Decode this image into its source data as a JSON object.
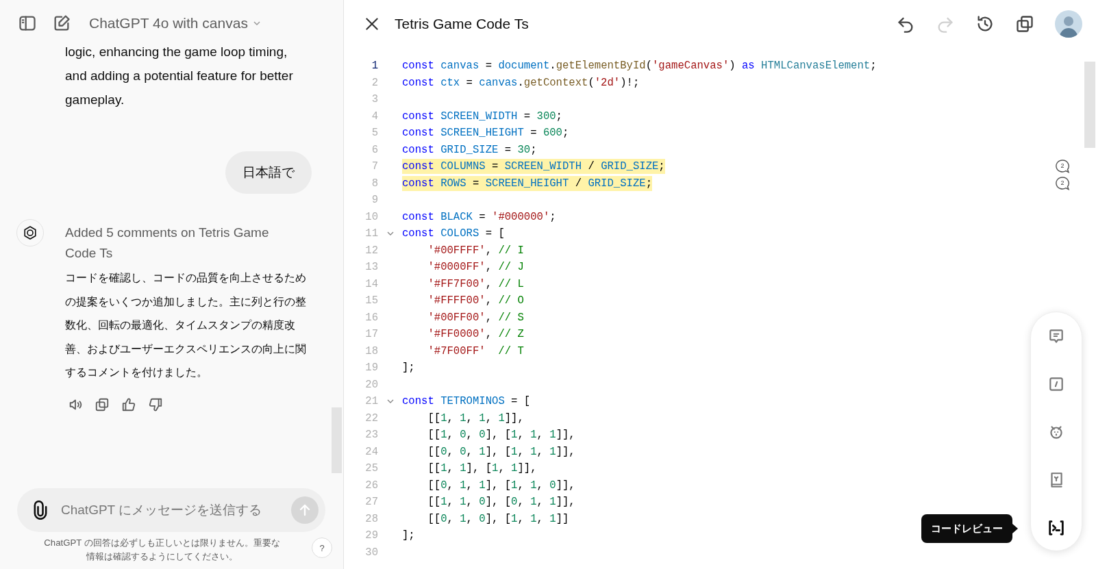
{
  "chat": {
    "model_selector": {
      "label": "ChatGPT 4o with canvas"
    },
    "messages": [
      {
        "kind": "assistant_text",
        "text": "logic, enhancing the game loop timing, and adding a potential feature for better gameplay."
      },
      {
        "kind": "user",
        "text": "日本語で"
      },
      {
        "kind": "assistant",
        "status": "Added 5 comments on Tetris Game Code Ts",
        "text": "コードを確認し、コードの品質を向上させるための提案をいくつか追加しました。主に列と行の整数化、回転の最適化、タイムスタンプの精度改善、およびユーザーエクスペリエンスの向上に関するコメントを付けました。"
      }
    ],
    "composer": {
      "placeholder": "ChatGPT にメッセージを送信する",
      "send_disabled": true
    },
    "disclaimer": "ChatGPT の回答は必ずしも正しいとは限りません。重要な情報は確認するようにしてください。",
    "help": "?"
  },
  "canvas": {
    "title": "Tetris Game Code Ts",
    "actions": [
      {
        "kind": "undo",
        "disabled": false
      },
      {
        "kind": "redo",
        "disabled": true
      },
      {
        "kind": "history",
        "disabled": false
      },
      {
        "kind": "copy",
        "disabled": false
      }
    ],
    "lines": [
      {
        "number": "1",
        "current": true,
        "highlighted": false,
        "tokens": [
          {
            "kind": "kw",
            "text": "const "
          },
          {
            "kind": "var",
            "text": "canvas"
          },
          {
            "kind": "plain",
            "text": " = "
          },
          {
            "kind": "var",
            "text": "document"
          },
          {
            "kind": "plain",
            "text": "."
          },
          {
            "kind": "fn",
            "text": "getElementById"
          },
          {
            "kind": "plain",
            "text": "("
          },
          {
            "kind": "str",
            "text": "'gameCanvas'"
          },
          {
            "kind": "plain",
            "text": ") "
          },
          {
            "kind": "kw",
            "text": "as "
          },
          {
            "kind": "type",
            "text": "HTMLCanvasElement"
          },
          {
            "kind": "plain",
            "text": ";"
          }
        ]
      },
      {
        "number": "2",
        "current": false,
        "highlighted": false,
        "tokens": [
          {
            "kind": "kw",
            "text": "const "
          },
          {
            "kind": "var",
            "text": "ctx"
          },
          {
            "kind": "plain",
            "text": " = "
          },
          {
            "kind": "var",
            "text": "canvas"
          },
          {
            "kind": "plain",
            "text": "."
          },
          {
            "kind": "fn",
            "text": "getContext"
          },
          {
            "kind": "plain",
            "text": "("
          },
          {
            "kind": "str",
            "text": "'2d'"
          },
          {
            "kind": "plain",
            "text": ")!;"
          }
        ]
      },
      {
        "number": "3",
        "current": false,
        "highlighted": false
      },
      {
        "number": "4",
        "current": false,
        "highlighted": false,
        "tokens": [
          {
            "kind": "kw",
            "text": "const "
          },
          {
            "kind": "var",
            "text": "SCREEN_WIDTH"
          },
          {
            "kind": "plain",
            "text": " = "
          },
          {
            "kind": "num",
            "text": "300"
          },
          {
            "kind": "plain",
            "text": ";"
          }
        ]
      },
      {
        "number": "5",
        "current": false,
        "highlighted": false,
        "tokens": [
          {
            "kind": "kw",
            "text": "const "
          },
          {
            "kind": "var",
            "text": "SCREEN_HEIGHT"
          },
          {
            "kind": "plain",
            "text": " = "
          },
          {
            "kind": "num",
            "text": "600"
          },
          {
            "kind": "plain",
            "text": ";"
          }
        ]
      },
      {
        "number": "6",
        "current": false,
        "highlighted": false,
        "tokens": [
          {
            "kind": "kw",
            "text": "const "
          },
          {
            "kind": "var",
            "text": "GRID_SIZE"
          },
          {
            "kind": "plain",
            "text": " = "
          },
          {
            "kind": "num",
            "text": "30"
          },
          {
            "kind": "plain",
            "text": ";"
          }
        ]
      },
      {
        "number": "7",
        "current": false,
        "highlighted": true,
        "comments": "2",
        "tokens": [
          {
            "kind": "kw",
            "text": "const "
          },
          {
            "kind": "var",
            "text": "COLUMNS"
          },
          {
            "kind": "plain",
            "text": " = "
          },
          {
            "kind": "var",
            "text": "SCREEN_WIDTH"
          },
          {
            "kind": "plain",
            "text": " / "
          },
          {
            "kind": "var",
            "text": "GRID_SIZE"
          },
          {
            "kind": "plain",
            "text": ";"
          }
        ]
      },
      {
        "number": "8",
        "current": false,
        "highlighted": true,
        "comments": "2",
        "tokens": [
          {
            "kind": "kw",
            "text": "const "
          },
          {
            "kind": "var",
            "text": "ROWS"
          },
          {
            "kind": "plain",
            "text": " = "
          },
          {
            "kind": "var",
            "text": "SCREEN_HEIGHT"
          },
          {
            "kind": "plain",
            "text": " / "
          },
          {
            "kind": "var",
            "text": "GRID_SIZE"
          },
          {
            "kind": "plain",
            "text": ";"
          }
        ]
      },
      {
        "number": "9",
        "current": false,
        "highlighted": false
      },
      {
        "number": "10",
        "current": false,
        "highlighted": false,
        "tokens": [
          {
            "kind": "kw",
            "text": "const "
          },
          {
            "kind": "var",
            "text": "BLACK"
          },
          {
            "kind": "plain",
            "text": " = "
          },
          {
            "kind": "str",
            "text": "'#000000'"
          },
          {
            "kind": "plain",
            "text": ";"
          }
        ]
      },
      {
        "number": "11",
        "current": false,
        "highlighted": false,
        "expanded": true,
        "tokens": [
          {
            "kind": "kw",
            "text": "const "
          },
          {
            "kind": "var",
            "text": "COLORS"
          },
          {
            "kind": "plain",
            "text": " = ["
          }
        ]
      },
      {
        "number": "12",
        "current": false,
        "highlighted": false,
        "tokens": [
          {
            "kind": "str",
            "text": "    '#00FFFF'"
          },
          {
            "kind": "plain",
            "text": ", "
          },
          {
            "kind": "cmt",
            "text": "// I"
          }
        ]
      },
      {
        "number": "13",
        "current": false,
        "highlighted": false,
        "tokens": [
          {
            "kind": "str",
            "text": "    '#0000FF'"
          },
          {
            "kind": "plain",
            "text": ", "
          },
          {
            "kind": "cmt",
            "text": "// J"
          }
        ]
      },
      {
        "number": "14",
        "current": false,
        "highlighted": false,
        "tokens": [
          {
            "kind": "str",
            "text": "    '#FF7F00'"
          },
          {
            "kind": "plain",
            "text": ", "
          },
          {
            "kind": "cmt",
            "text": "// L"
          }
        ]
      },
      {
        "number": "15",
        "current": false,
        "highlighted": false,
        "tokens": [
          {
            "kind": "str",
            "text": "    '#FFFF00'"
          },
          {
            "kind": "plain",
            "text": ", "
          },
          {
            "kind": "cmt",
            "text": "// O"
          }
        ]
      },
      {
        "number": "16",
        "current": false,
        "highlighted": false,
        "tokens": [
          {
            "kind": "str",
            "text": "    '#00FF00'"
          },
          {
            "kind": "plain",
            "text": ", "
          },
          {
            "kind": "cmt",
            "text": "// S"
          }
        ]
      },
      {
        "number": "17",
        "current": false,
        "highlighted": false,
        "tokens": [
          {
            "kind": "str",
            "text": "    '#FF0000'"
          },
          {
            "kind": "plain",
            "text": ", "
          },
          {
            "kind": "cmt",
            "text": "// Z"
          }
        ]
      },
      {
        "number": "18",
        "current": false,
        "highlighted": false,
        "tokens": [
          {
            "kind": "str",
            "text": "    '#7F00FF'"
          },
          {
            "kind": "cmt",
            "text": "  // T"
          }
        ]
      },
      {
        "number": "19",
        "current": false,
        "highlighted": false,
        "tokens": [
          {
            "kind": "plain",
            "text": "];"
          }
        ]
      },
      {
        "number": "20",
        "current": false,
        "highlighted": false
      },
      {
        "number": "21",
        "current": false,
        "highlighted": false,
        "expanded": true,
        "tokens": [
          {
            "kind": "kw",
            "text": "const "
          },
          {
            "kind": "var",
            "text": "TETROMINOS"
          },
          {
            "kind": "plain",
            "text": " = ["
          }
        ]
      },
      {
        "number": "22",
        "current": false,
        "highlighted": false,
        "tokens": [
          {
            "kind": "plain",
            "text": "    [["
          },
          {
            "kind": "num",
            "text": "1"
          },
          {
            "kind": "plain",
            "text": ", "
          },
          {
            "kind": "num",
            "text": "1"
          },
          {
            "kind": "plain",
            "text": ", "
          },
          {
            "kind": "num",
            "text": "1"
          },
          {
            "kind": "plain",
            "text": ", "
          },
          {
            "kind": "num",
            "text": "1"
          },
          {
            "kind": "plain",
            "text": "]],"
          }
        ]
      },
      {
        "number": "23",
        "current": false,
        "highlighted": false,
        "tokens": [
          {
            "kind": "plain",
            "text": "    [["
          },
          {
            "kind": "num",
            "text": "1"
          },
          {
            "kind": "plain",
            "text": ", "
          },
          {
            "kind": "num",
            "text": "0"
          },
          {
            "kind": "plain",
            "text": ", "
          },
          {
            "kind": "num",
            "text": "0"
          },
          {
            "kind": "plain",
            "text": "], ["
          },
          {
            "kind": "num",
            "text": "1"
          },
          {
            "kind": "plain",
            "text": ", "
          },
          {
            "kind": "num",
            "text": "1"
          },
          {
            "kind": "plain",
            "text": ", "
          },
          {
            "kind": "num",
            "text": "1"
          },
          {
            "kind": "plain",
            "text": "]],"
          }
        ]
      },
      {
        "number": "24",
        "current": false,
        "highlighted": false,
        "tokens": [
          {
            "kind": "plain",
            "text": "    [["
          },
          {
            "kind": "num",
            "text": "0"
          },
          {
            "kind": "plain",
            "text": ", "
          },
          {
            "kind": "num",
            "text": "0"
          },
          {
            "kind": "plain",
            "text": ", "
          },
          {
            "kind": "num",
            "text": "1"
          },
          {
            "kind": "plain",
            "text": "], ["
          },
          {
            "kind": "num",
            "text": "1"
          },
          {
            "kind": "plain",
            "text": ", "
          },
          {
            "kind": "num",
            "text": "1"
          },
          {
            "kind": "plain",
            "text": ", "
          },
          {
            "kind": "num",
            "text": "1"
          },
          {
            "kind": "plain",
            "text": "]],"
          }
        ]
      },
      {
        "number": "25",
        "current": false,
        "highlighted": false,
        "tokens": [
          {
            "kind": "plain",
            "text": "    [["
          },
          {
            "kind": "num",
            "text": "1"
          },
          {
            "kind": "plain",
            "text": ", "
          },
          {
            "kind": "num",
            "text": "1"
          },
          {
            "kind": "plain",
            "text": "], ["
          },
          {
            "kind": "num",
            "text": "1"
          },
          {
            "kind": "plain",
            "text": ", "
          },
          {
            "kind": "num",
            "text": "1"
          },
          {
            "kind": "plain",
            "text": "]],"
          }
        ]
      },
      {
        "number": "26",
        "current": false,
        "highlighted": false,
        "tokens": [
          {
            "kind": "plain",
            "text": "    [["
          },
          {
            "kind": "num",
            "text": "0"
          },
          {
            "kind": "plain",
            "text": ", "
          },
          {
            "kind": "num",
            "text": "1"
          },
          {
            "kind": "plain",
            "text": ", "
          },
          {
            "kind": "num",
            "text": "1"
          },
          {
            "kind": "plain",
            "text": "], ["
          },
          {
            "kind": "num",
            "text": "1"
          },
          {
            "kind": "plain",
            "text": ", "
          },
          {
            "kind": "num",
            "text": "1"
          },
          {
            "kind": "plain",
            "text": ", "
          },
          {
            "kind": "num",
            "text": "0"
          },
          {
            "kind": "plain",
            "text": "]],"
          }
        ]
      },
      {
        "number": "27",
        "current": false,
        "highlighted": false,
        "tokens": [
          {
            "kind": "plain",
            "text": "    [["
          },
          {
            "kind": "num",
            "text": "1"
          },
          {
            "kind": "plain",
            "text": ", "
          },
          {
            "kind": "num",
            "text": "1"
          },
          {
            "kind": "plain",
            "text": ", "
          },
          {
            "kind": "num",
            "text": "0"
          },
          {
            "kind": "plain",
            "text": "], ["
          },
          {
            "kind": "num",
            "text": "0"
          },
          {
            "kind": "plain",
            "text": ", "
          },
          {
            "kind": "num",
            "text": "1"
          },
          {
            "kind": "plain",
            "text": ", "
          },
          {
            "kind": "num",
            "text": "1"
          },
          {
            "kind": "plain",
            "text": "]],"
          }
        ]
      },
      {
        "number": "28",
        "current": false,
        "highlighted": false,
        "tokens": [
          {
            "kind": "plain",
            "text": "    [["
          },
          {
            "kind": "num",
            "text": "0"
          },
          {
            "kind": "plain",
            "text": ", "
          },
          {
            "kind": "num",
            "text": "1"
          },
          {
            "kind": "plain",
            "text": ", "
          },
          {
            "kind": "num",
            "text": "0"
          },
          {
            "kind": "plain",
            "text": "], ["
          },
          {
            "kind": "num",
            "text": "1"
          },
          {
            "kind": "plain",
            "text": ", "
          },
          {
            "kind": "num",
            "text": "1"
          },
          {
            "kind": "plain",
            "text": ", "
          },
          {
            "kind": "num",
            "text": "1"
          },
          {
            "kind": "plain",
            "text": "]]"
          }
        ]
      },
      {
        "number": "29",
        "current": false,
        "highlighted": false,
        "tokens": [
          {
            "kind": "plain",
            "text": "];"
          }
        ]
      },
      {
        "number": "30",
        "current": false,
        "highlighted": false
      }
    ],
    "tool_menu": {
      "tooltip": "コードレビュー",
      "items": [
        {
          "kind": "comment",
          "selected": false
        },
        {
          "kind": "edit",
          "selected": false
        },
        {
          "kind": "bug",
          "selected": false
        },
        {
          "kind": "book",
          "selected": false
        },
        {
          "kind": "terminal",
          "selected": true
        }
      ]
    }
  }
}
